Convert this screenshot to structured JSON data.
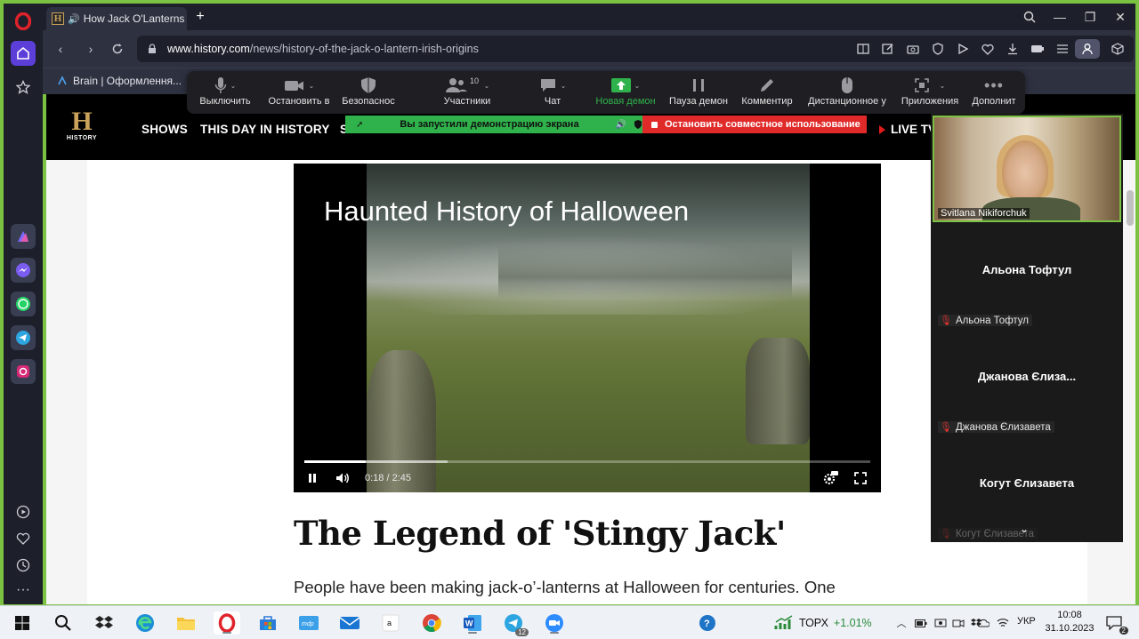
{
  "browser": {
    "tab": {
      "title": "How Jack O'Lanterns"
    },
    "url_domain": "www.history.com",
    "url_path": "/news/history-of-the-jack-o-lantern-irish-origins",
    "bookmark": "Brain | Оформлення..."
  },
  "site": {
    "logo_letter": "H",
    "logo_text": "HISTORY",
    "nav": [
      "SHOWS",
      "THIS DAY IN HISTORY",
      "S"
    ],
    "live_tv": "LIVE TV"
  },
  "video": {
    "title": "Haunted History of Halloween",
    "time_current": "0:18",
    "time_sep": "/",
    "time_total": "2:45",
    "progress_fraction": 0.109,
    "buffered_fraction": 0.253
  },
  "article": {
    "title": "The Legend of 'Stingy Jack'",
    "body_start": "People have been making jack-o’-lanterns at Halloween for centuries. One"
  },
  "zoom_toolbar": {
    "items": [
      {
        "label": "Выключить",
        "icon": "microphone-icon"
      },
      {
        "label": "Остановить в",
        "icon": "video-camera-icon"
      },
      {
        "label": "Безопаснос",
        "icon": "shield-icon"
      },
      {
        "label": "Участники",
        "icon": "participants-icon",
        "count": "10"
      },
      {
        "label": "Чат",
        "icon": "chat-icon"
      },
      {
        "label": "Новая демон",
        "icon": "share-screen-icon"
      },
      {
        "label": "Пауза демон",
        "icon": "pause-icon"
      },
      {
        "label": "Комментир",
        "icon": "pencil-icon"
      },
      {
        "label": "Дистанционное у",
        "icon": "mouse-icon"
      },
      {
        "label": "Приложения",
        "icon": "apps-icon"
      },
      {
        "label": "Дополнит",
        "icon": "more-icon"
      }
    ],
    "share_banner": "Вы запустили демонстрацию экрана",
    "stop_share": "Остановить совместное использование"
  },
  "participants": {
    "video_name": "Svitlana Nikiforchuk",
    "tiles": [
      {
        "big": "Альона Тофтул",
        "small": "Альона Тофтул"
      },
      {
        "big": "Джанова Єлиза...",
        "small": "Джанова Єлизавета"
      },
      {
        "big": "Когут Єлизавета",
        "small": "Когут Єлизавета"
      }
    ]
  },
  "taskbar": {
    "stock_name": "ТОРХ",
    "stock_change": "+1.01%",
    "lang": "УКР",
    "time": "10:08",
    "date": "31.10.2023",
    "telegram_badge": "12",
    "notif_badge": "2"
  },
  "colors": {
    "share_border": "#7cc242",
    "opera_red": "#e0222a",
    "history_gold": "#c9a15a",
    "zoom_green": "#2fb24b",
    "zoom_red": "#e02a2a"
  }
}
